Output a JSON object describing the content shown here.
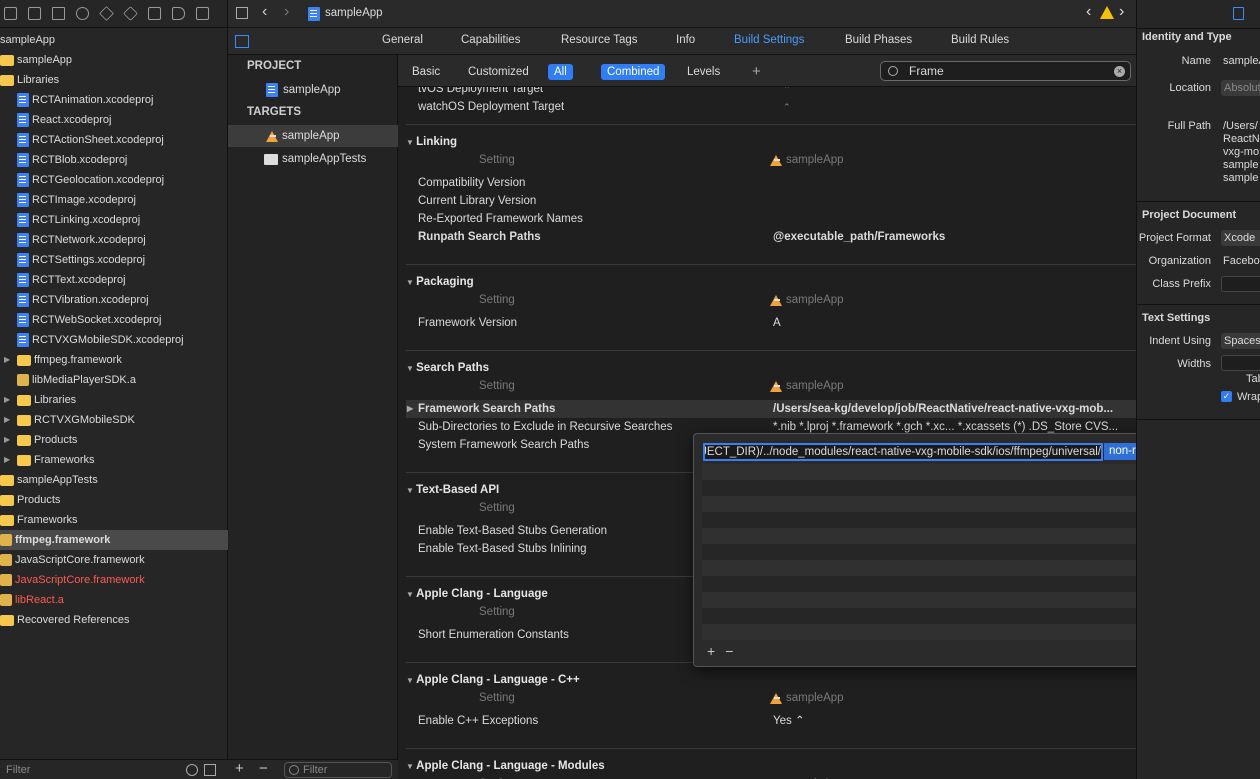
{
  "navigator": {
    "toolbar_icons": [
      "folder-icon",
      "source-control-icon",
      "symbol-icon",
      "find-icon",
      "issue-warning-icon",
      "test-icon",
      "debug-icon",
      "breakpoint-icon",
      "report-icon"
    ],
    "items": [
      {
        "label": "sampleApp",
        "kind": "project",
        "color": "",
        "selected": false,
        "indent": 0,
        "tri": ""
      },
      {
        "label": "sampleApp",
        "kind": "folder",
        "color": "",
        "selected": false,
        "indent": 0,
        "tri": ""
      },
      {
        "label": "Libraries",
        "kind": "folder",
        "color": "",
        "selected": false,
        "indent": 0,
        "tri": ""
      },
      {
        "label": "RCTAnimation.xcodeproj",
        "kind": "file",
        "color": "",
        "selected": false,
        "indent": 1,
        "tri": ""
      },
      {
        "label": "React.xcodeproj",
        "kind": "file",
        "color": "",
        "selected": false,
        "indent": 1,
        "tri": ""
      },
      {
        "label": "RCTActionSheet.xcodeproj",
        "kind": "file",
        "color": "",
        "selected": false,
        "indent": 1,
        "tri": ""
      },
      {
        "label": "RCTBlob.xcodeproj",
        "kind": "file",
        "color": "",
        "selected": false,
        "indent": 1,
        "tri": ""
      },
      {
        "label": "RCTGeolocation.xcodeproj",
        "kind": "file",
        "color": "",
        "selected": false,
        "indent": 1,
        "tri": ""
      },
      {
        "label": "RCTImage.xcodeproj",
        "kind": "file",
        "color": "",
        "selected": false,
        "indent": 1,
        "tri": ""
      },
      {
        "label": "RCTLinking.xcodeproj",
        "kind": "file",
        "color": "",
        "selected": false,
        "indent": 1,
        "tri": ""
      },
      {
        "label": "RCTNetwork.xcodeproj",
        "kind": "file",
        "color": "",
        "selected": false,
        "indent": 1,
        "tri": ""
      },
      {
        "label": "RCTSettings.xcodeproj",
        "kind": "file",
        "color": "",
        "selected": false,
        "indent": 1,
        "tri": ""
      },
      {
        "label": "RCTText.xcodeproj",
        "kind": "file",
        "color": "",
        "selected": false,
        "indent": 1,
        "tri": ""
      },
      {
        "label": "RCTVibration.xcodeproj",
        "kind": "file",
        "color": "",
        "selected": false,
        "indent": 1,
        "tri": ""
      },
      {
        "label": "RCTWebSocket.xcodeproj",
        "kind": "file",
        "color": "",
        "selected": false,
        "indent": 1,
        "tri": ""
      },
      {
        "label": "RCTVXGMobileSDK.xcodeproj",
        "kind": "file",
        "color": "",
        "selected": false,
        "indent": 1,
        "tri": ""
      },
      {
        "label": "ffmpeg.framework",
        "kind": "folder",
        "color": "",
        "selected": false,
        "indent": 1,
        "tri": "▶"
      },
      {
        "label": "libMediaPlayerSDK.a",
        "kind": "box",
        "color": "",
        "selected": false,
        "indent": 1,
        "tri": ""
      },
      {
        "label": "Libraries",
        "kind": "folder",
        "color": "",
        "selected": false,
        "indent": 1,
        "tri": "▶"
      },
      {
        "label": "RCTVXGMobileSDK",
        "kind": "folder",
        "color": "",
        "selected": false,
        "indent": 1,
        "tri": "▶"
      },
      {
        "label": "Products",
        "kind": "folder",
        "color": "",
        "selected": false,
        "indent": 1,
        "tri": "▶"
      },
      {
        "label": "Frameworks",
        "kind": "folder",
        "color": "",
        "selected": false,
        "indent": 1,
        "tri": "▶"
      },
      {
        "label": "sampleAppTests",
        "kind": "folder",
        "color": "",
        "selected": false,
        "indent": 0,
        "tri": ""
      },
      {
        "label": "Products",
        "kind": "folder",
        "color": "",
        "selected": false,
        "indent": 0,
        "tri": ""
      },
      {
        "label": "Frameworks",
        "kind": "folder",
        "color": "",
        "selected": false,
        "indent": 0,
        "tri": ""
      },
      {
        "label": "ffmpeg.framework",
        "kind": "box",
        "color": "",
        "selected": true,
        "indent": 0,
        "tri": ""
      },
      {
        "label": "JavaScriptCore.framework",
        "kind": "box",
        "color": "",
        "selected": false,
        "indent": 0,
        "tri": ""
      },
      {
        "label": "JavaScriptCore.framework",
        "kind": "box",
        "color": "#ff5a52",
        "selected": false,
        "indent": 0,
        "tri": ""
      },
      {
        "label": "libReact.a",
        "kind": "box",
        "color": "#ff5a52",
        "selected": false,
        "indent": 0,
        "tri": ""
      },
      {
        "label": "Recovered References",
        "kind": "folder",
        "color": "",
        "selected": false,
        "indent": 0,
        "tri": ""
      }
    ],
    "filter_placeholder": "Filter"
  },
  "jumpbar": {
    "title": "sampleApp"
  },
  "tabs": [
    "General",
    "Capabilities",
    "Resource Tags",
    "Info",
    "Build Settings",
    "Build Phases",
    "Build Rules"
  ],
  "active_tab": "Build Settings",
  "targets_panel": {
    "project_header": "PROJECT",
    "project": "sampleApp",
    "targets_header": "TARGETS",
    "targets": [
      "sampleApp",
      "sampleAppTests"
    ],
    "filter_placeholder": "Filter"
  },
  "filterbar": {
    "basic": "Basic",
    "customized": "Customized",
    "all": "All",
    "combined": "Combined",
    "levels": "Levels",
    "add": "+",
    "search_value": "Frame"
  },
  "settings": {
    "partial_rows": [
      {
        "key": "tvOS Deployment Target",
        "value": "⌃"
      },
      {
        "key": "watchOS Deployment Target",
        "value": "⌃"
      }
    ],
    "setting_header": "Setting",
    "target_col": "sampleApp",
    "sections": [
      {
        "title": "Linking",
        "rows": [
          {
            "key": "Compatibility Version",
            "value": ""
          },
          {
            "key": "Current Library Version",
            "value": ""
          },
          {
            "key": "Re-Exported Framework Names",
            "value": ""
          },
          {
            "key": "Runpath Search Paths",
            "value": "@executable_path/Frameworks",
            "bold": true
          }
        ]
      },
      {
        "title": "Packaging",
        "rows": [
          {
            "key": "Framework Version",
            "value": "A"
          }
        ]
      },
      {
        "title": "Search Paths",
        "rows": [
          {
            "key": "Framework Search Paths",
            "value": "/Users/sea-kg/develop/job/ReactNative/react-native-vxg-mob...",
            "bold": true,
            "tri": "▶"
          },
          {
            "key": "Sub-Directories to Exclude in Recursive Searches",
            "value": "*.nib *.lproj *.framework *.gch *.xc... *.xcassets (*) .DS_Store CVS..."
          },
          {
            "key": "System Framework Search Paths",
            "value": ""
          }
        ]
      },
      {
        "title": "Text-Based API",
        "rows": [
          {
            "key": "Enable Text-Based Stubs Generation",
            "value": ""
          },
          {
            "key": "Enable Text-Based Stubs Inlining",
            "value": ""
          }
        ]
      },
      {
        "title": "Apple Clang - Language",
        "rows": [
          {
            "key": "Short Enumeration Constants",
            "value": ""
          }
        ]
      },
      {
        "title": "Apple Clang - Language - C++",
        "rows": [
          {
            "key": "Enable C++ Exceptions",
            "value": "Yes ⌃"
          }
        ]
      },
      {
        "title": "Apple Clang - Language - Modules",
        "rows": []
      }
    ]
  },
  "popup": {
    "path_value": "$(PROJECT_DIR)/../node_modules/react-native-vxg-mobile-sdk/ios/ffmpeg/universal/",
    "recursion": "non-recursive",
    "add": "+",
    "remove": "−"
  },
  "inspector": {
    "identity_title": "Identity and Type",
    "name_label": "Name",
    "name_value": "sampleApp",
    "location_label": "Location",
    "location_value": "Absolute",
    "fullpath_label": "Full Path",
    "fullpath_lines": [
      "/Users/",
      "ReactN",
      "vxg-mo",
      "sample",
      "sample"
    ],
    "projdoc_title": "Project Document",
    "format_label": "Project Format",
    "format_value": "Xcode",
    "org_label": "Organization",
    "org_value": "Facebo",
    "prefix_label": "Class Prefix",
    "prefix_value": "",
    "text_title": "Text Settings",
    "indent_label": "Indent Using",
    "indent_value": "Spaces",
    "widths_label": "Widths",
    "widths_value": "",
    "tab_label": "Tab",
    "wrap_label": "Wrap"
  },
  "colors": {
    "accent": "#2f7ef5",
    "warning": "#f5c400",
    "error": "#ff5a52",
    "folder": "#f6c84c"
  }
}
